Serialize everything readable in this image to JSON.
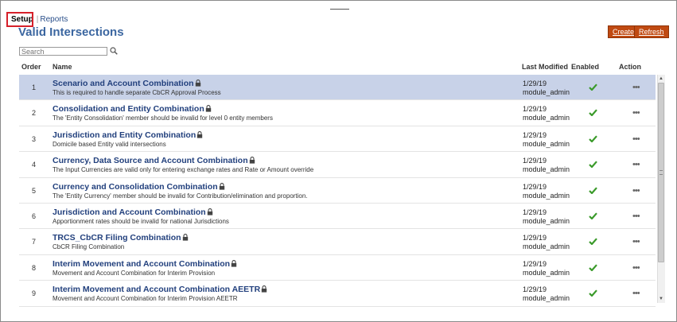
{
  "tabs": {
    "setup": "Setup",
    "separator": "|",
    "reports": "Reports"
  },
  "page_title": "Valid Intersections",
  "buttons": {
    "create": "Create",
    "refresh": "Refresh"
  },
  "search": {
    "placeholder": "Search"
  },
  "columns": {
    "order": "Order",
    "name": "Name",
    "last_modified": "Last Modified",
    "enabled": "Enabled",
    "action": "Action"
  },
  "colors": {
    "accent": "#c04a12",
    "title": "#3b66a0",
    "row_title": "#22407d",
    "selected_row": "#c8d2e8",
    "check": "#3a9a2a",
    "highlight": "#d6202a"
  },
  "rows": [
    {
      "order": "1",
      "title": "Scenario and Account Combination",
      "desc": "This is required to handle separate CbCR Approval Process",
      "date": "1/29/19",
      "user": "module_admin",
      "selected": true
    },
    {
      "order": "2",
      "title": "Consolidation and Entity Combination",
      "desc": "The 'Entity Consolidation' member should be invalid for level 0 entity members",
      "date": "1/29/19",
      "user": "module_admin",
      "selected": false
    },
    {
      "order": "3",
      "title": "Jurisdiction and Entity Combination",
      "desc": "Domicile based Entity valid intersections",
      "date": "1/29/19",
      "user": "module_admin",
      "selected": false
    },
    {
      "order": "4",
      "title": "Currency, Data Source and Account Combination",
      "desc": "The Input Currencies are valid only for entering exchange rates and Rate or Amount override",
      "date": "1/29/19",
      "user": "module_admin",
      "selected": false
    },
    {
      "order": "5",
      "title": "Currency and Consolidation Combination",
      "desc": "The 'Entity Currency' member should be invalid for Contribution/elimination and proportion.",
      "date": "1/29/19",
      "user": "module_admin",
      "selected": false
    },
    {
      "order": "6",
      "title": "Jurisdiction and Account Combination",
      "desc": "Apportionment rates should be invalid for national Jurisdictions",
      "date": "1/29/19",
      "user": "module_admin",
      "selected": false
    },
    {
      "order": "7",
      "title": "TRCS_CbCR Filing Combination",
      "desc": "CbCR Filing Combination",
      "date": "1/29/19",
      "user": "module_admin",
      "selected": false
    },
    {
      "order": "8",
      "title": "Interim Movement and Account Combination",
      "desc": "Movement and Account Combination for Interim Provision",
      "date": "1/29/19",
      "user": "module_admin",
      "selected": false
    },
    {
      "order": "9",
      "title": "Interim Movement and Account Combination AEETR",
      "desc": "Movement and Account Combination for Interim Provision AEETR",
      "date": "1/29/19",
      "user": "module_admin",
      "selected": false
    }
  ],
  "action_glyph": "•••"
}
